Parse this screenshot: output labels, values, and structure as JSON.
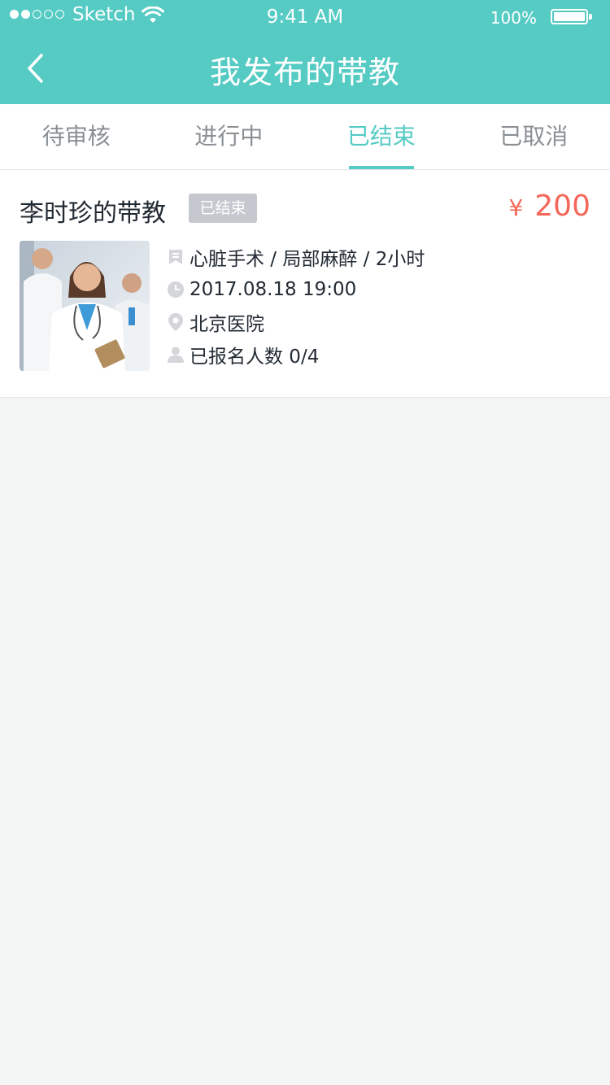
{
  "status_bar": {
    "carrier": "Sketch",
    "time": "9:41 AM",
    "battery": "100%"
  },
  "header": {
    "title": "我发布的带教",
    "back_icon": "chevron-left-icon"
  },
  "tabs": [
    {
      "label": "待审核",
      "active": false
    },
    {
      "label": "进行中",
      "active": false
    },
    {
      "label": "已结束",
      "active": true
    },
    {
      "label": "已取消",
      "active": false
    }
  ],
  "card": {
    "title": "李时珍的带教",
    "status": "已结束",
    "currency": "¥",
    "price": "200",
    "details": "心脏手术 / 局部麻醉 / 2小时",
    "datetime": "2017.08.18   19:00",
    "location": "北京医院",
    "enrollment": "已报名人数 0/4"
  },
  "colors": {
    "accent": "#55cbc4",
    "price": "#f4675a",
    "badge": "#c5c8cf",
    "icon": "#d4d6da"
  }
}
